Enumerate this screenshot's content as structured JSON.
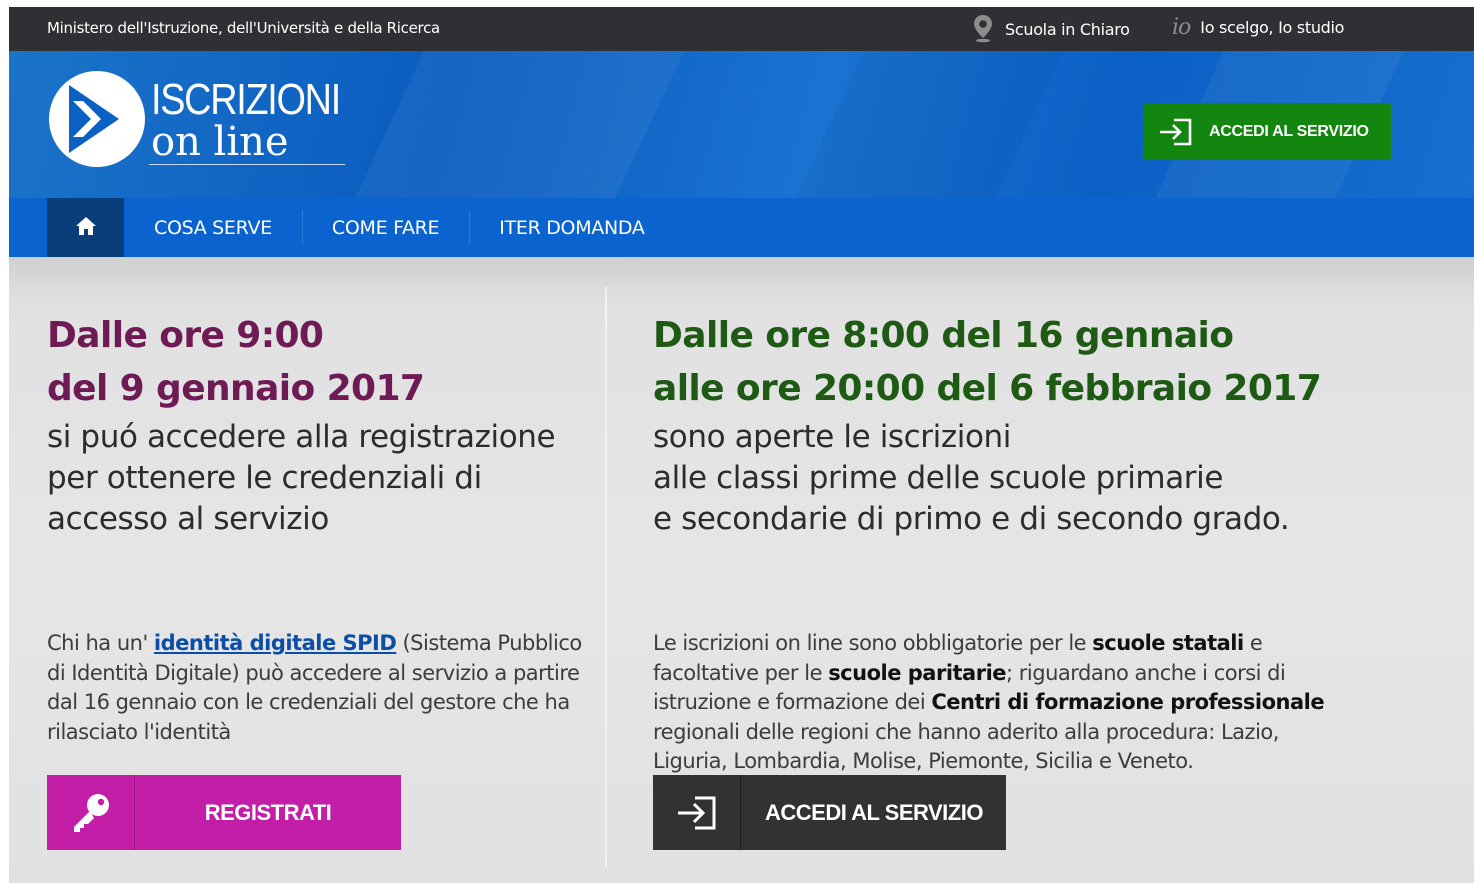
{
  "topbar": {
    "ministry": "Ministero dell'Istruzione, dell'Università e della Ricerca",
    "links": [
      {
        "label": "Scuola in Chiaro",
        "icon": "map-pin-icon"
      },
      {
        "label": "Io scelgo, Io studio",
        "icon": "io-logo-icon",
        "logo_text": "io"
      }
    ]
  },
  "header": {
    "logo_title": "ISCRIZIONI",
    "logo_subtitle": "on line",
    "access_button": "ACCEDI AL SERVIZIO"
  },
  "nav": {
    "home_icon": "home-icon",
    "items": [
      "COSA SERVE",
      "COME FARE",
      "ITER DOMANDA"
    ]
  },
  "left": {
    "date_lines": [
      "Dalle ore 9:00",
      "del 9 gennaio 2017"
    ],
    "subtitle_lines": [
      "si puó accedere alla registrazione",
      "per ottenere le credenziali di",
      "accesso al servizio"
    ],
    "para_before_link": "Chi ha un' ",
    "para_link": "identità digitale SPID",
    "para_after_link": " (Sistema Pubblico di Identità Digitale) può accedere al servizio a partire dal 16 gennaio con le credenziali del gestore che ha rilasciato l'identità",
    "button": "REGISTRATI",
    "button_icon": "key-icon"
  },
  "right": {
    "date_lines": [
      "Dalle ore 8:00 del 16 gennaio",
      "alle ore 20:00 del 6 febbraio 2017"
    ],
    "subtitle_lines": [
      "sono aperte le iscrizioni",
      "alle classi prime delle scuole primarie",
      "e secondarie di primo e di secondo grado."
    ],
    "para_parts": {
      "t1": "Le iscrizioni on line sono obbligatorie per le ",
      "b1": "scuole statali",
      "t2": " e facoltative per le ",
      "b2": "scuole paritarie",
      "t3": "; riguardano anche i corsi di istruzione e formazione dei ",
      "b3": "Centri di formazione professionale",
      "t4": " regionali delle regioni che hanno aderito alla procedura: Lazio, Liguria, Lombardia, Molise, Piemonte, Sicilia e Veneto."
    },
    "button": "ACCEDI AL SERVIZIO",
    "button_icon": "sign-in-icon"
  },
  "colors": {
    "topbar": "#2e3033",
    "header_blue": "#0b63cf",
    "nav_home": "#0a3e7a",
    "green_button": "#13860f",
    "magenta_button": "#c21ea8",
    "dark_button": "#303234",
    "left_heading": "#6e1a55",
    "right_heading": "#1e5a13"
  }
}
